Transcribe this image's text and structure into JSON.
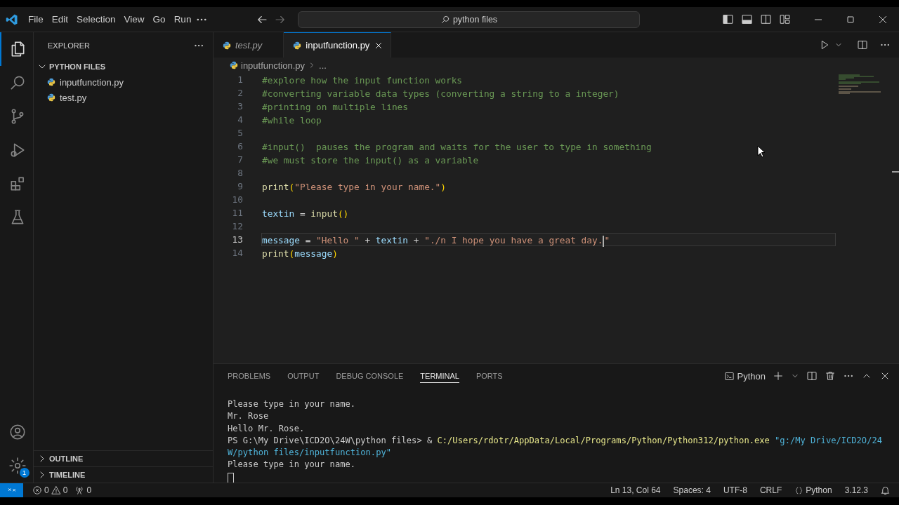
{
  "title_bar": {
    "menu": [
      "File",
      "Edit",
      "Selection",
      "View",
      "Go",
      "Run"
    ],
    "nav": [
      {
        "kind": "back",
        "disabled": false
      },
      {
        "kind": "forward",
        "disabled": true
      }
    ],
    "search": {
      "value": "python files"
    }
  },
  "activity_bar": {
    "items": [
      {
        "kind": "files",
        "selected": true
      },
      {
        "kind": "search",
        "selected": false
      },
      {
        "kind": "source-control",
        "selected": false
      },
      {
        "kind": "run-debug",
        "selected": false
      },
      {
        "kind": "extensions",
        "selected": false
      },
      {
        "kind": "testing",
        "selected": false
      }
    ],
    "settings_badge": "1"
  },
  "sidebar": {
    "title": "EXPLORER",
    "folder": {
      "name": "PYTHON FILES",
      "expanded": true,
      "children": [
        {
          "name": "inputfunction.py"
        },
        {
          "name": "test.py"
        }
      ]
    },
    "sections": [
      {
        "name": "OUTLINE",
        "expanded": false
      },
      {
        "name": "TIMELINE",
        "expanded": false
      }
    ]
  },
  "editor": {
    "tabs": [
      {
        "label": "test.py",
        "selected": false,
        "preview": true
      },
      {
        "label": "inputfunction.py",
        "selected": true,
        "preview": false
      }
    ],
    "breadcrumb": {
      "file": "inputfunction.py",
      "rest": "..."
    },
    "lines": [
      {
        "number": "1",
        "current": false,
        "tokens": [
          {
            "kind": "comment",
            "text": "#explore how the input function works"
          }
        ]
      },
      {
        "number": "2",
        "current": false,
        "tokens": [
          {
            "kind": "comment",
            "text": "#converting variable data types (converting a string to a integer)"
          }
        ]
      },
      {
        "number": "3",
        "current": false,
        "tokens": [
          {
            "kind": "comment",
            "text": "#printing on multiple lines"
          }
        ]
      },
      {
        "number": "4",
        "current": false,
        "tokens": [
          {
            "kind": "comment",
            "text": "#while loop"
          }
        ]
      },
      {
        "number": "5",
        "current": false
      },
      {
        "number": "6",
        "current": false,
        "tokens": [
          {
            "kind": "comment",
            "text": "#input()  pauses the program and waits for the user to type in something"
          }
        ]
      },
      {
        "number": "7",
        "current": false,
        "tokens": [
          {
            "kind": "comment",
            "text": "#we must store the input() as a variable"
          }
        ]
      },
      {
        "number": "8",
        "current": false
      },
      {
        "number": "9",
        "current": false,
        "tokens": [
          {
            "kind": "func",
            "text": "print"
          },
          {
            "kind": "bracket",
            "text": "("
          },
          {
            "kind": "string",
            "text": "\"Please type in your name.\""
          },
          {
            "kind": "bracket",
            "text": ")"
          }
        ]
      },
      {
        "number": "10",
        "current": false
      },
      {
        "number": "11",
        "current": false,
        "tokens": [
          {
            "kind": "var",
            "text": "textin"
          },
          {
            "kind": "op",
            "text": " = "
          },
          {
            "kind": "func",
            "text": "input"
          },
          {
            "kind": "bracket",
            "text": "()"
          }
        ]
      },
      {
        "number": "12",
        "current": false
      },
      {
        "number": "13",
        "current": true,
        "tokens": [
          {
            "kind": "var",
            "text": "message"
          },
          {
            "kind": "op",
            "text": " = "
          },
          {
            "kind": "string",
            "text": "\"Hello \""
          },
          {
            "kind": "op",
            "text": " + "
          },
          {
            "kind": "var",
            "text": "textin"
          },
          {
            "kind": "op",
            "text": " + "
          },
          {
            "kind": "string",
            "text": "\"./n I hope you have a great day."
          },
          {
            "kind": "string",
            "text": "\"",
            "caret_before": true
          }
        ]
      },
      {
        "number": "14",
        "current": false,
        "tokens": [
          {
            "kind": "func",
            "text": "print"
          },
          {
            "kind": "bracket",
            "text": "("
          },
          {
            "kind": "var",
            "text": "message"
          },
          {
            "kind": "bracket",
            "text": ")"
          }
        ]
      }
    ]
  },
  "panel": {
    "tabs": [
      {
        "label": "PROBLEMS",
        "selected": false
      },
      {
        "label": "OUTPUT",
        "selected": false
      },
      {
        "label": "DEBUG CONSOLE",
        "selected": false
      },
      {
        "label": "TERMINAL",
        "selected": true
      },
      {
        "label": "PORTS",
        "selected": false
      }
    ],
    "terminal_name": "Python",
    "lines": [
      {
        "tokens": [
          {
            "kind": "plain",
            "text": "Please type in your name."
          }
        ]
      },
      {
        "tokens": [
          {
            "kind": "plain",
            "text": "Mr. Rose"
          }
        ]
      },
      {
        "tokens": [
          {
            "kind": "plain",
            "text": "Hello Mr. Rose."
          }
        ]
      },
      {
        "tokens": [
          {
            "kind": "plain",
            "text": "PS G:\\My Drive\\ICD2O\\24W\\python files> & "
          },
          {
            "kind": "path",
            "text": "C:/Users/rdotr/AppData/Local/Programs/Python/Python312/python.exe"
          },
          {
            "kind": "string",
            "text": " \"g:/My Drive/ICD2O/24"
          }
        ]
      },
      {
        "tokens": [
          {
            "kind": "string",
            "text": "W/python files/inputfunction.py\""
          }
        ]
      },
      {
        "tokens": [
          {
            "kind": "plain",
            "text": "Please type in your name."
          }
        ]
      }
    ],
    "cursor": true
  },
  "status_bar": {
    "errors": "0",
    "warnings": "0",
    "ports": "0",
    "items": [
      "Ln 13, Col 64",
      "Spaces: 4",
      "UTF-8",
      "CRLF"
    ],
    "language": "Python",
    "version": "3.12.3"
  }
}
